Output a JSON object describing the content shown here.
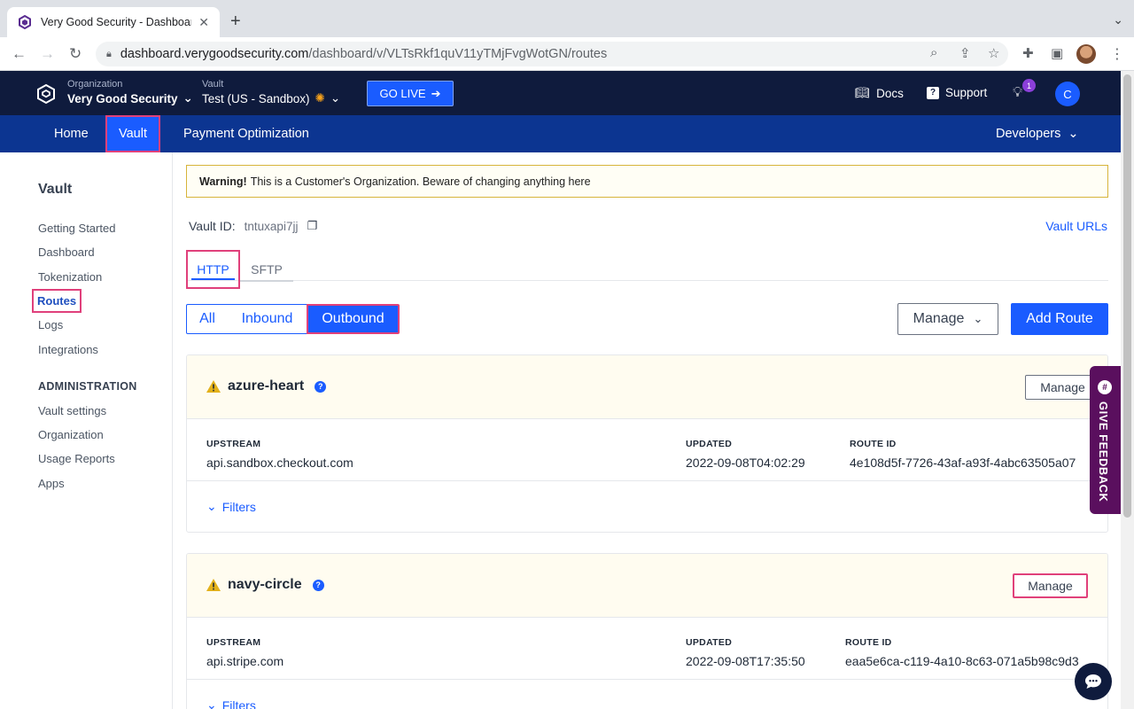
{
  "browser": {
    "tab_title": "Very Good Security - Dashboard",
    "url_domain": "dashboard.verygoodsecurity.com",
    "url_path": "/dashboard/v/VLTsRkf1quV11yTMjFvgWotGN/routes"
  },
  "header": {
    "org_label": "Organization",
    "org_name": "Very Good Security",
    "vault_label": "Vault",
    "vault_name": "Test  (US - Sandbox)",
    "go_live": "GO LIVE",
    "docs": "Docs",
    "support": "Support",
    "notification_count": "1",
    "user_initial": "C"
  },
  "nav": {
    "home": "Home",
    "vault": "Vault",
    "payment_optimization": "Payment Optimization",
    "developers": "Developers"
  },
  "sidebar": {
    "title": "Vault",
    "items": [
      "Getting Started",
      "Dashboard",
      "Tokenization",
      "Routes",
      "Logs",
      "Integrations"
    ],
    "admin_title": "ADMINISTRATION",
    "admin_items": [
      "Vault settings",
      "Organization",
      "Usage Reports",
      "Apps"
    ]
  },
  "main": {
    "warning_bold": "Warning!",
    "warning_text": "This is a Customer's Organization. Beware of changing anything here",
    "vault_id_label": "Vault ID:",
    "vault_id_value": "tntuxapi7jj",
    "vault_urls": "Vault URLs",
    "tabs": [
      "HTTP",
      "SFTP"
    ],
    "filters": [
      "All",
      "Inbound",
      "Outbound"
    ],
    "manage": "Manage",
    "add_route": "Add Route"
  },
  "routes": [
    {
      "name": "azure-heart",
      "manage": "Manage",
      "upstream_label": "UPSTREAM",
      "upstream": "api.sandbox.checkout.com",
      "updated_label": "UPDATED",
      "updated": "2022-09-08T04:02:29",
      "route_id_label": "ROUTE ID",
      "route_id": "4e108d5f-7726-43af-a93f-4abc63505a07",
      "filters": "Filters"
    },
    {
      "name": "navy-circle",
      "manage": "Manage",
      "upstream_label": "UPSTREAM",
      "upstream": "api.stripe.com",
      "updated_label": "UPDATED",
      "updated": "2022-09-08T17:35:50",
      "route_id_label": "ROUTE ID",
      "route_id": "eaa5e6ca-c119-4a10-8c63-071a5b98c9d3",
      "filters": "Filters"
    }
  ],
  "feedback": "GIVE FEEDBACK",
  "colors": {
    "header_bg": "#0f1b3d",
    "nav_bg": "#0c3591",
    "accent": "#1a5cff",
    "highlight": "#e0407b",
    "card_head_bg": "#fffcf0",
    "feedback_bg": "#5a0f5e"
  }
}
